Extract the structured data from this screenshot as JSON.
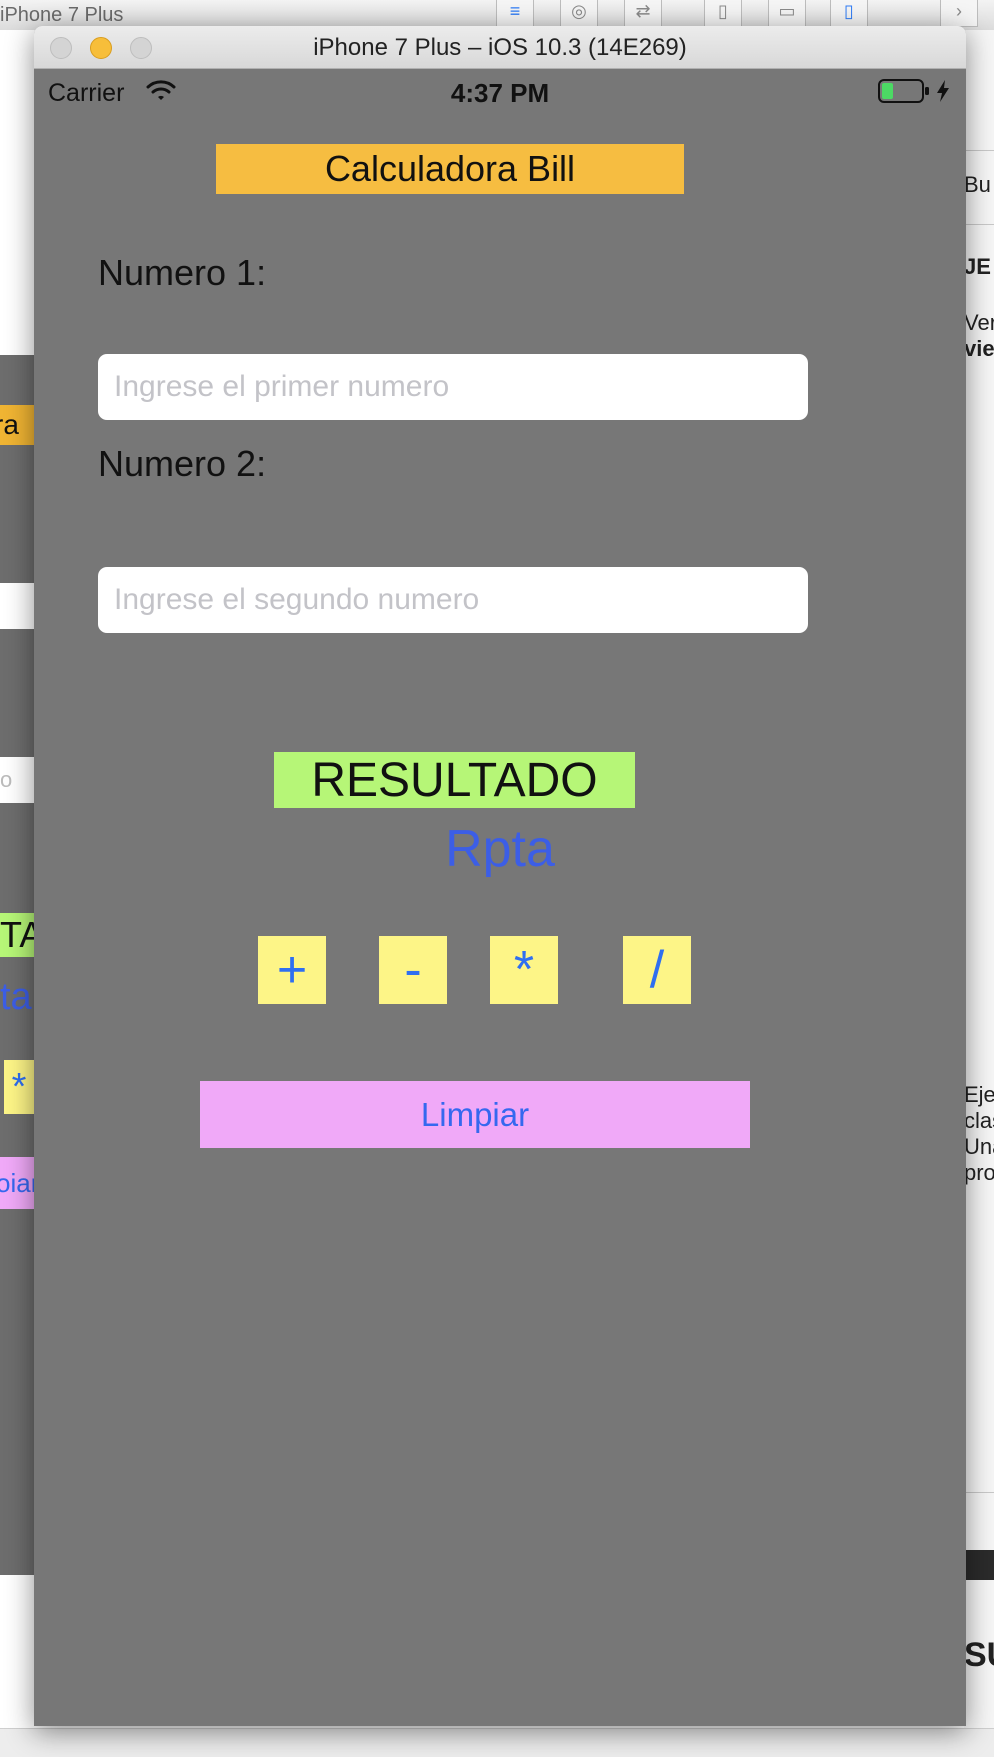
{
  "xcode_background": {
    "scheme_title": "iPhone 7 Plus",
    "toolbar_glyphs": [
      "≡",
      "◎",
      "⇄",
      "▯",
      "▭",
      "▯",
      "›"
    ],
    "storyboard_fragments": {
      "title": "ra",
      "placeholder": "o",
      "result": "TA",
      "rpta": "ta",
      "op": "*",
      "clear": "oiar"
    },
    "inspector_fragments": [
      "Bu",
      "JE",
      "Ver",
      "vie",
      "Eje",
      "clas",
      "Una",
      "pro",
      "SU"
    ]
  },
  "window": {
    "title": "iPhone 7 Plus – iOS 10.3 (14E269)"
  },
  "status_bar": {
    "carrier": "Carrier",
    "time": "4:37 PM",
    "battery_level": 0.3,
    "charging": true
  },
  "app": {
    "title": "Calculadora Bill",
    "label1": "Numero 1:",
    "input1_placeholder": "Ingrese el primer numero",
    "label2": "Numero 2:",
    "input2_placeholder": "Ingrese el segundo numero",
    "result_label": "RESULTADO",
    "result_value": "Rpta",
    "ops": {
      "add": "+",
      "subtract": "-",
      "multiply": "*",
      "divide": "/"
    },
    "clear": "Limpiar"
  },
  "colors": {
    "screen_bg": "#777777",
    "title_bg": "#f6bd41",
    "result_bg": "#b6f677",
    "op_bg": "#fdf587",
    "clear_bg": "#f0a9f8",
    "accent_blue": "#3568ef"
  },
  "icons": {
    "wifi": "wifi-icon",
    "battery": "battery-icon",
    "charging": "charging-bolt-icon"
  }
}
